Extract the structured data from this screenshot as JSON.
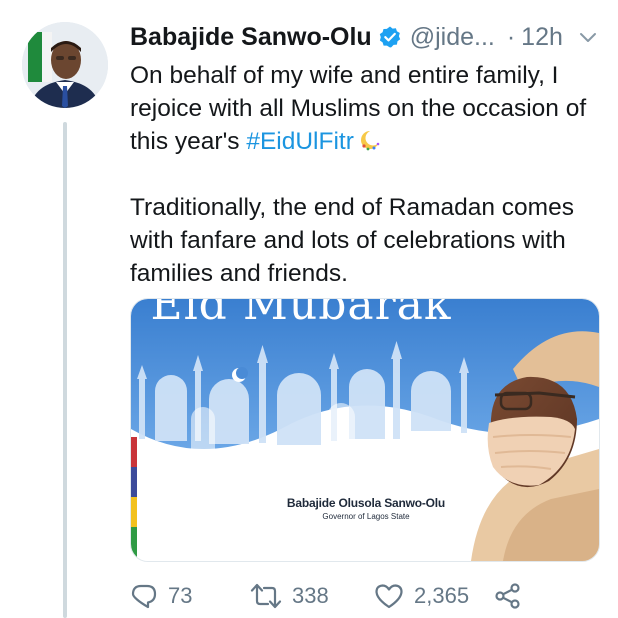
{
  "author": {
    "name": "Babajide Sanwo-Olu",
    "handle": "@jide...",
    "time_ago": "12h",
    "separator": "·"
  },
  "tweet": {
    "line1_text": "On behalf of my wife and entire family, I rejoice with all Muslims on the occasion of this year's ",
    "hashtag": "#EidUlFitr",
    "paragraph2": "Traditionally, the end of Ramadan comes with fanfare and lots of celebrations with families and friends."
  },
  "media": {
    "title": "Eid Mubarak",
    "signature_name": "Babajide Olusola Sanwo-Olu",
    "signature_title": "Governor of Lagos State",
    "colors": {
      "sky_top": "#3a7fd0",
      "sky_bottom": "#5b9ae0",
      "stripe_red": "#c8343a",
      "stripe_blue": "#3b4a9a",
      "stripe_yellow": "#f2c11e",
      "stripe_green": "#2f9a44"
    }
  },
  "actions": {
    "reply_count": "73",
    "retweet_count": "338",
    "like_count": "2,365"
  },
  "icons": {
    "verified": "verified-badge-icon",
    "chevron": "chevron-down-icon",
    "reply": "reply-icon",
    "retweet": "retweet-icon",
    "like": "heart-icon",
    "share": "share-icon"
  },
  "colors": {
    "text": "#14171a",
    "muted": "#657786",
    "link": "#1b95e0",
    "verified": "#1da1f2"
  }
}
